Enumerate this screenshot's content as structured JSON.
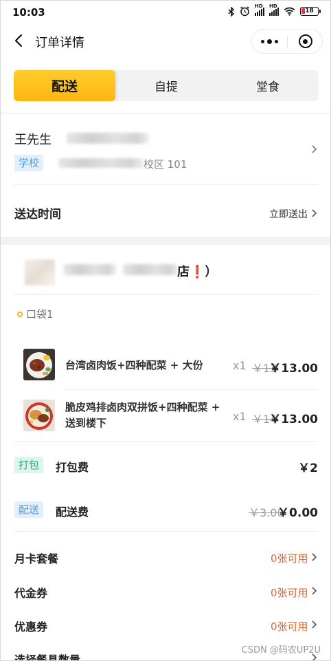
{
  "status_bar": {
    "time": "10:03",
    "battery": "18",
    "signal_1_label": "HD",
    "signal_2_label": "HD"
  },
  "nav": {
    "title": "订单详情",
    "back_icon": "chevron-left-icon",
    "more_icon": "more-dots-icon",
    "close_icon": "miniprogram-close-icon"
  },
  "mode_tabs": [
    {
      "label": "配送",
      "active": true
    },
    {
      "label": "自提",
      "active": false
    },
    {
      "label": "堂食",
      "active": false
    }
  ],
  "address": {
    "name": "王先生",
    "tag": "学校",
    "address_tail": "校区 101"
  },
  "delivery_time": {
    "label": "送达时间",
    "value": "立即送出"
  },
  "store": {
    "name_tail": "店",
    "exclaim": "❗",
    "close_paren": "）"
  },
  "bag_label": "口袋1",
  "items": [
    {
      "name": "台湾卤肉饭+四种配菜 + 大份",
      "qty": "x1",
      "original_price": "￥13",
      "price": "￥13.00"
    },
    {
      "name_line1": "脆皮鸡排卤肉双拼饭+四种配菜 +",
      "name_line2": "送到楼下",
      "qty": "x1",
      "original_price": "￥14",
      "price": "￥13.00"
    }
  ],
  "packing_fee": {
    "tag": "打包",
    "label": "打包费",
    "value": "￥2"
  },
  "delivery_fee": {
    "tag": "配送",
    "label": "配送费",
    "original": "￥3.00",
    "value": "￥0.00"
  },
  "benefits": [
    {
      "label": "月卡套餐",
      "value": "0张可用"
    },
    {
      "label": "代金券",
      "value": "0张可用"
    },
    {
      "label": "优惠券",
      "value": "0张可用"
    },
    {
      "label": "选择餐具数量",
      "value": ""
    }
  ],
  "watermark": "CSDN @码农UP2U",
  "colors": {
    "accent_yellow": "#fdb513",
    "orange_text": "#e06a3c",
    "tag_blue_bg": "#e3effa",
    "tag_green_bg": "#def5ee"
  }
}
